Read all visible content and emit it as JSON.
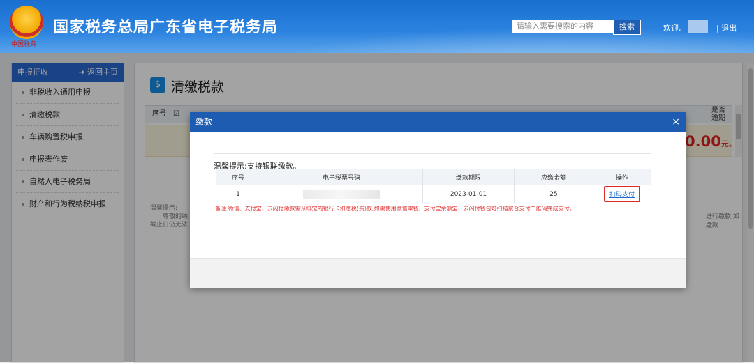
{
  "header": {
    "emblem_sub": "中国税务",
    "site_title": "国家税务总局广东省电子税务局",
    "search_placeholder": "请输入需要搜索的内容",
    "search_button": "搜索",
    "welcome": "欢迎,",
    "logout": "| 退出"
  },
  "sidebar": {
    "title": "申报征收",
    "back": "返回主页",
    "items": [
      {
        "label": "非税收入通用申报"
      },
      {
        "label": "清缴税款"
      },
      {
        "label": "车辆购置税申报"
      },
      {
        "label": "申报表作废"
      },
      {
        "label": "自然人电子税务局"
      },
      {
        "label": "财产和行为税纳税申报"
      }
    ]
  },
  "main": {
    "title": "清缴税款",
    "col_seq": "序号",
    "col_overdue": "是否逾期",
    "amount": "0.00",
    "amount_unit": "元。",
    "notice_title": "温馨提示:",
    "notice_line1": "尊敬的纳",
    "notice_line2": "截止日仍无法",
    "notice_right": "进行缴款,如缴款"
  },
  "modal": {
    "title": "缴款",
    "close": "×",
    "warm_tip": "温馨提示:支持银联缴款。",
    "columns": [
      "序号",
      "电子税票号码",
      "缴款期限",
      "应缴金额",
      "操作"
    ],
    "rows": [
      {
        "seq": "1",
        "ticket": "",
        "deadline": "2023-01-01",
        "amount": "25",
        "action": "扫码支付"
      }
    ],
    "remark": "备注:微信、支付宝、云闪付缴款需从绑定的银行卡扣缴税(费)款;如需使用微信零钱、支付宝余额宝、云闪付钱包可扫描聚合支付二维码完成支付。"
  }
}
